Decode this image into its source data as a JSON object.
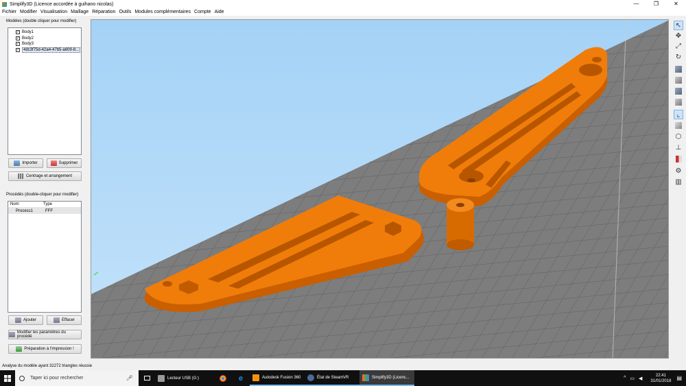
{
  "window": {
    "title": "Simplify3D (Licence accordée à guihano nicolas)",
    "controls": {
      "minimize": "—",
      "maximize": "❐",
      "close": "✕"
    }
  },
  "menu": [
    "Fichier",
    "Modifier",
    "Visualisation",
    "Maillage",
    "Réparation",
    "Outils",
    "Modules complémentaires",
    "Compte",
    "Aide"
  ],
  "models": {
    "label": "Modèles (double cliquer pour modifier)",
    "items": [
      {
        "name": "Body1",
        "checked": true
      },
      {
        "name": "Body2",
        "checked": true
      },
      {
        "name": "Body3",
        "checked": true
      },
      {
        "name": "4dc3f75d-42a4-47b5-a609-8...",
        "checked": true,
        "selected": true
      }
    ],
    "import_label": "Importer",
    "delete_label": "Supprimer",
    "center_label": "Centrage et arrangement"
  },
  "processes": {
    "label": "Procédés (double-cliquer pour modifier)",
    "col_name": "Nom",
    "col_type": "Type",
    "rows": [
      {
        "name": "Process1",
        "type": "FFF"
      }
    ],
    "add_label": "Ajouter",
    "erase_label": "Effacer",
    "edit_label": "Modifier les paramètres du procédé",
    "prepare_label": "Préparation à l'impression !"
  },
  "status": "Analyse du modèle ayant 32272 triangles réussie",
  "taskbar": {
    "search_placeholder": "Taper ici pour rechercher",
    "items": [
      {
        "label": "Lecteur USB (G:)",
        "color": "#9a9a9a"
      },
      {
        "label": "",
        "color": "#ea4335"
      },
      {
        "label": "",
        "color": "#1e88e5"
      },
      {
        "label": "Autodesk Fusion 360",
        "color": "#f29111"
      },
      {
        "label": "État de SteamVR",
        "color": "#4a6b9a"
      },
      {
        "label": "Simplify3D (Licenc...",
        "color": "#5a9e3a"
      }
    ],
    "time": "22:41",
    "date": "31/01/2018"
  },
  "colors": {
    "part": "#f07d0a",
    "sky": "#a8d6f8",
    "bed": "#7a7a7a",
    "grid": "#5e5e5e"
  },
  "toolbar_icons": [
    "select-icon",
    "move-icon",
    "scale-icon",
    "rotate-icon",
    "view-front-icon",
    "view-top-icon",
    "view-left-icon",
    "view-iso-icon",
    "axis-icon",
    "solid-icon",
    "wireframe-icon",
    "cross-section-icon",
    "build-volume-icon",
    "settings-icon",
    "gear-icon",
    "supports-icon"
  ]
}
